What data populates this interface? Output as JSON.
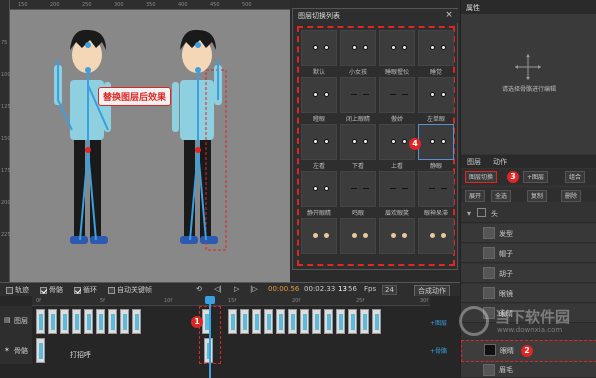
{
  "canvas": {
    "ruler_left_ticks": [
      "75",
      "100",
      "125",
      "150",
      "175",
      "200",
      "225"
    ],
    "ruler_top_ticks": [
      "150",
      "200",
      "250",
      "300",
      "350",
      "400",
      "450",
      "500"
    ],
    "bubble_label": "替换图层后效果"
  },
  "layer_panel": {
    "title": "图层切换列表",
    "close_label": "×",
    "cells": [
      {
        "label": "默认",
        "eyes": "w"
      },
      {
        "label": "小女孩",
        "eyes": "w"
      },
      {
        "label": "睡眼惺忪",
        "eyes": "w"
      },
      {
        "label": "睡觉",
        "eyes": "w"
      },
      {
        "label": "瞪眼",
        "eyes": "w"
      },
      {
        "label": "闭上眼睛",
        "eyes": "c"
      },
      {
        "label": "傲娇",
        "eyes": "c"
      },
      {
        "label": "左单眼",
        "eyes": "w"
      },
      {
        "label": "左看",
        "eyes": "w"
      },
      {
        "label": "下看",
        "eyes": "w"
      },
      {
        "label": "上看",
        "eyes": "w"
      },
      {
        "label": "静眼",
        "eyes": "w"
      },
      {
        "label": "静开眼睛",
        "eyes": "w"
      },
      {
        "label": "鸣眼",
        "eyes": "c"
      },
      {
        "label": "眉欢眼笑",
        "eyes": "c"
      },
      {
        "label": "眼神呆滞",
        "eyes": "c"
      },
      {
        "label": "",
        "eyes": "o"
      },
      {
        "label": "",
        "eyes": "o"
      },
      {
        "label": "",
        "eyes": "o"
      },
      {
        "label": "",
        "eyes": "o"
      }
    ],
    "badge4": "4"
  },
  "right_panel": {
    "title": "属性",
    "hint": "请选择骨骼进行编辑",
    "tabs": [
      "图层",
      "动作"
    ],
    "toolbar1": {
      "layer_switch": "图层切换",
      "plus_layer": "+图层",
      "group": "组合"
    },
    "badge3": "3",
    "toolbar2": {
      "expand": "展开",
      "select_all": "全选",
      "copy": "复制",
      "delete": "删除"
    },
    "tree_root": "头",
    "rows": [
      "发型",
      "帽子",
      "胡子",
      "眼镜",
      "眼睛",
      "眉毛"
    ],
    "badge2": "2"
  },
  "controls": {
    "track": "轨迹",
    "bone": "骨骼",
    "loop": "循环",
    "auto_key": "自动关键帧",
    "time_current": "00:00.56",
    "time_total": "00:02.33",
    "frame_cur": "13",
    "frame_total": "56",
    "fps_label": "Fps",
    "fps_value": "24",
    "compose": "合成动作"
  },
  "timeline": {
    "ruler": [
      "0f",
      "5f",
      "10f",
      "15f",
      "20f",
      "25f",
      "30f"
    ],
    "row1_label": "图层",
    "row2_label": "骨骼",
    "row2_action": "打招呼",
    "add_layer": "+图层",
    "add_bone": "+骨骼",
    "badge1": "1"
  },
  "watermark": {
    "main": "当下软件园",
    "sub": "www.downxia.com"
  },
  "colors": {
    "accent": "#e02525",
    "blue": "#3aa0e0",
    "shirt": "#8fd0e0"
  }
}
